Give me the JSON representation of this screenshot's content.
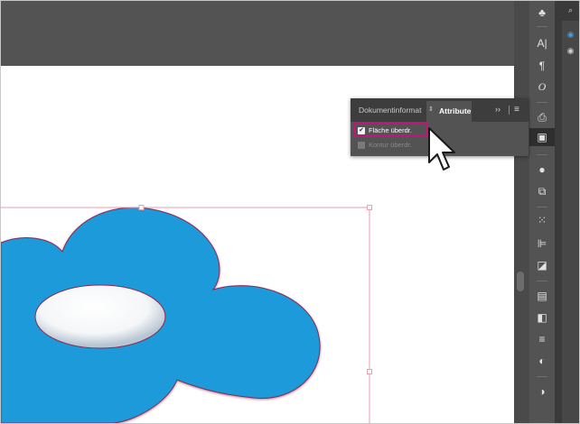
{
  "panel": {
    "tabs": [
      {
        "label": "Dokumentinformat",
        "active": false
      },
      {
        "label": "Attribute",
        "active": true
      }
    ],
    "collapse_icon": "double-chevron-right",
    "menu_icon": "hamburger-menu",
    "options": [
      {
        "label": "Fläche überdr.",
        "checked": true,
        "enabled": true
      },
      {
        "label": "Kontur überdr.",
        "checked": false,
        "enabled": false
      }
    ],
    "highlight_color": "#c0157a"
  },
  "toolbar": {
    "icons": [
      "club-icon",
      "character-icon",
      "paragraph-icon",
      "opentype-icon",
      "document-info-icon",
      "attributes-icon",
      "appearance-icon",
      "transform-icon",
      "grid-icon",
      "align-icon",
      "pathfinder-icon",
      "image-trace-icon",
      "gradient-icon",
      "stroke-icon",
      "transparency-icon",
      "color-guide-icon"
    ]
  },
  "right_panel": {
    "icons": [
      "search-icon",
      "eye-icon",
      "eye-icon"
    ]
  },
  "artwork": {
    "shape_color": "#1a9ad9",
    "bounding_box_color": "#e8a0ac",
    "workspace_color": "#535353"
  }
}
